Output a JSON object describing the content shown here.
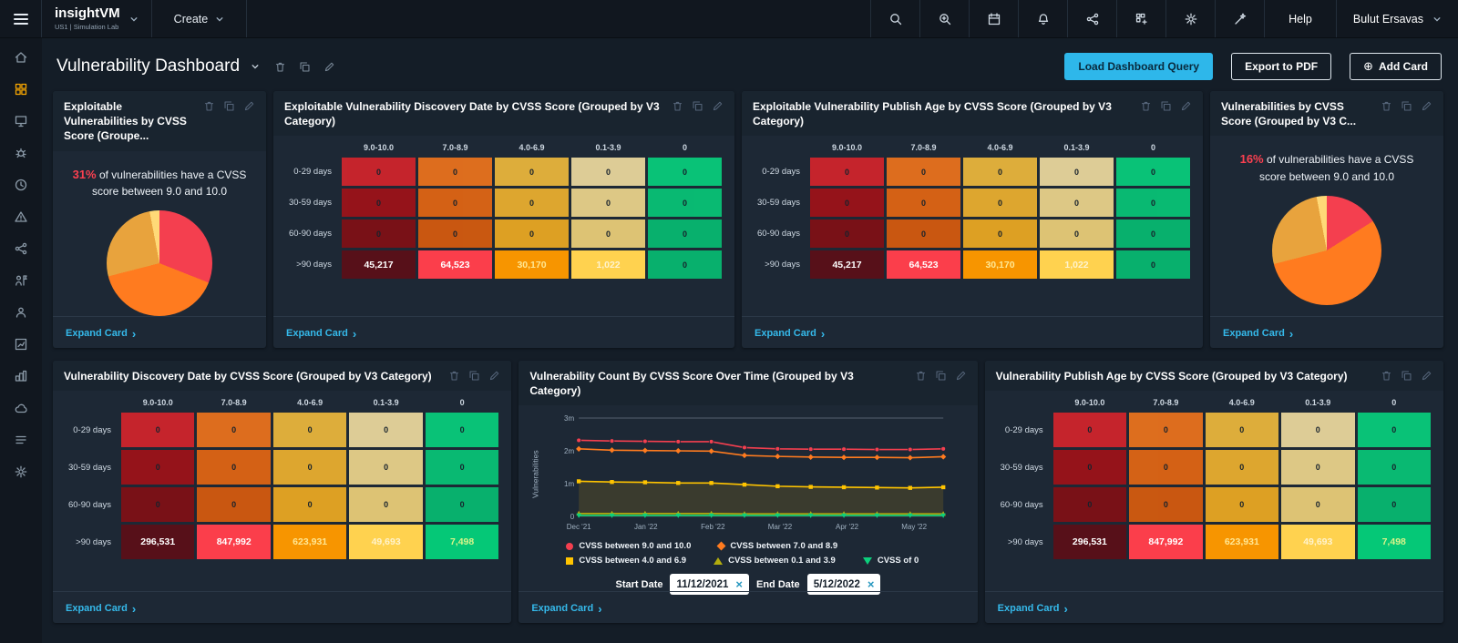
{
  "colors": {
    "accent_cyan": "#2eb7ea",
    "active_sidebar_icon": "#f7a600",
    "stat_red": "#fb4050",
    "page_background": "#141d27",
    "card_background": "#1d2835"
  },
  "topbar": {
    "brand": "insightVM",
    "brand_sub": "US1 | Simulation Lab",
    "create_label": "Create",
    "help_label": "Help",
    "user_name": "Bulut Ersavas",
    "icons": [
      "search",
      "query",
      "calendar",
      "notifications",
      "automation",
      "apps",
      "settings",
      "tools"
    ]
  },
  "sidebar": {
    "items": [
      "home",
      "dashboards",
      "assets",
      "vulnerabilities",
      "policies",
      "remediations",
      "automation",
      "goals",
      "users",
      "reports",
      "containers",
      "cloud",
      "queries",
      "settings"
    ],
    "active": "dashboards"
  },
  "page": {
    "title": "Vulnerability Dashboard",
    "actions": {
      "load_query": "Load Dashboard Query",
      "export_pdf": "Export to PDF",
      "add_card": "Add Card"
    }
  },
  "cards": {
    "pie_exploitable": {
      "title": "Exploitable Vulnerabilities by CVSS Score (Groupe...",
      "stat_pct": "31%",
      "stat_text": "of vulnerabilities have a CVSS score between 9.0 and 10.0",
      "expand": "Expand Card"
    },
    "heat_exploit_discovery": {
      "title": "Exploitable Vulnerability Discovery Date by CVSS Score (Grouped by V3 Category)",
      "expand": "Expand Card"
    },
    "heat_exploit_publish": {
      "title": "Exploitable Vulnerability Publish Age by CVSS Score (Grouped by V3 Category)",
      "expand": "Expand Card"
    },
    "pie_all": {
      "title": "Vulnerabilities by CVSS Score (Grouped by V3 C...",
      "stat_pct": "16%",
      "stat_text": "of vulnerabilities have a CVSS score between 9.0 and 10.0",
      "expand": "Expand Card"
    },
    "heat_discovery": {
      "title": "Vulnerability Discovery Date by CVSS Score (Grouped by V3 Category)",
      "expand": "Expand Card"
    },
    "line_over_time": {
      "title": "Vulnerability Count By CVSS Score Over Time (Grouped by V3 Category)",
      "start_label": "Start Date",
      "start_value": "11/12/2021",
      "end_label": "End Date",
      "end_value": "5/12/2022",
      "expand": "Expand Card"
    },
    "heat_publish": {
      "title": "Vulnerability Publish Age by CVSS Score (Grouped by V3 Category)",
      "expand": "Expand Card"
    }
  },
  "heatmap_palette": {
    "cells": [
      [
        "#e3242b",
        "#ff7a1a",
        "#ffc53d",
        "#ffe9a8",
        "#06dd83"
      ],
      [
        "#aa1016",
        "#f56c10",
        "#ffbd2e",
        "#ffe494",
        "#06d37d"
      ],
      [
        "#8a0d12",
        "#e8600b",
        "#ffb520",
        "#ffdf7f",
        "#05c877"
      ],
      [
        "#571019",
        "#fb3e4b",
        "#f79500",
        "#ffd24f",
        "#05c877"
      ]
    ],
    "row4_text": [
      "#ffffff",
      "#ffffff",
      "#ffe793",
      "#fff3cd",
      "#d9f48a"
    ],
    "zero_text": "#17212b"
  },
  "chart_data": [
    {
      "id": "pie_exploitable",
      "type": "pie",
      "title": "Exploitable Vulnerabilities by CVSS Score",
      "values": [
        31,
        40,
        26,
        3
      ],
      "colors": [
        "#f43f4f",
        "#ff7b1f",
        "#e8a33d",
        "#ffd977"
      ]
    },
    {
      "id": "heat_exploit_discovery",
      "type": "heatmap",
      "title": "Exploitable Vulnerability Discovery Date by CVSS Score (Grouped by V3 Category)",
      "columns": [
        "9.0-10.0",
        "7.0-8.9",
        "4.0-6.9",
        "0.1-3.9",
        "0"
      ],
      "rows": [
        "0-29 days",
        "30-59 days",
        "60-90 days",
        ">90 days"
      ],
      "values": [
        [
          "0",
          "0",
          "0",
          "0",
          "0"
        ],
        [
          "0",
          "0",
          "0",
          "0",
          "0"
        ],
        [
          "0",
          "0",
          "0",
          "0",
          "0"
        ],
        [
          "45,217",
          "64,523",
          "30,170",
          "1,022",
          "0"
        ]
      ]
    },
    {
      "id": "heat_exploit_publish",
      "type": "heatmap",
      "title": "Exploitable Vulnerability Publish Age by CVSS Score (Grouped by V3 Category)",
      "columns": [
        "9.0-10.0",
        "7.0-8.9",
        "4.0-6.9",
        "0.1-3.9",
        "0"
      ],
      "rows": [
        "0-29 days",
        "30-59 days",
        "60-90 days",
        ">90 days"
      ],
      "values": [
        [
          "0",
          "0",
          "0",
          "0",
          "0"
        ],
        [
          "0",
          "0",
          "0",
          "0",
          "0"
        ],
        [
          "0",
          "0",
          "0",
          "0",
          "0"
        ],
        [
          "45,217",
          "64,523",
          "30,170",
          "1,022",
          "0"
        ]
      ]
    },
    {
      "id": "pie_all",
      "type": "pie",
      "title": "Vulnerabilities by CVSS Score",
      "values": [
        16,
        55,
        26,
        3
      ],
      "colors": [
        "#f43f4f",
        "#ff7b1f",
        "#e8a33d",
        "#ffd977"
      ]
    },
    {
      "id": "heat_discovery",
      "type": "heatmap",
      "title": "Vulnerability Discovery Date by CVSS Score (Grouped by V3 Category)",
      "columns": [
        "9.0-10.0",
        "7.0-8.9",
        "4.0-6.9",
        "0.1-3.9",
        "0"
      ],
      "rows": [
        "0-29 days",
        "30-59 days",
        "60-90 days",
        ">90 days"
      ],
      "values": [
        [
          "0",
          "0",
          "0",
          "0",
          "0"
        ],
        [
          "0",
          "0",
          "0",
          "0",
          "0"
        ],
        [
          "0",
          "0",
          "0",
          "0",
          "0"
        ],
        [
          "296,531",
          "847,992",
          "623,931",
          "49,693",
          "7,498"
        ]
      ]
    },
    {
      "id": "line_over_time",
      "type": "line",
      "title": "Vulnerability Count By CVSS Score Over Time (Grouped by V3 Category)",
      "ylabel": "Vulnerabilities",
      "yticks": [
        "0",
        "1m",
        "2m",
        "3m"
      ],
      "ylim_millions": [
        0,
        3
      ],
      "x_ticks": [
        "Dec '21",
        "Jan '22",
        "Feb '22",
        "Mar '22",
        "Apr '22",
        "May '22"
      ],
      "series": [
        {
          "name": "CVSS between 9.0 and 10.0",
          "color": "#f43f4f",
          "marker": "circle",
          "values_millions": [
            2.32,
            2.3,
            2.29,
            2.28,
            2.28,
            2.1,
            2.06,
            2.05,
            2.05,
            2.04,
            2.04,
            2.06
          ]
        },
        {
          "name": "CVSS between 7.0 and 8.9",
          "color": "#ff7b1f",
          "marker": "diamond",
          "values_millions": [
            2.06,
            2.02,
            2.01,
            2.0,
            1.99,
            1.86,
            1.83,
            1.81,
            1.8,
            1.8,
            1.79,
            1.82
          ]
        },
        {
          "name": "CVSS between 4.0 and 6.9",
          "color": "#ffc400",
          "marker": "square",
          "values_millions": [
            1.07,
            1.05,
            1.04,
            1.02,
            1.02,
            0.97,
            0.92,
            0.9,
            0.89,
            0.88,
            0.87,
            0.89
          ]
        },
        {
          "name": "CVSS between 0.1 and 3.9",
          "color": "#b3ad0e",
          "marker": "triangle-up",
          "values_millions": [
            0.09,
            0.09,
            0.09,
            0.09,
            0.09,
            0.08,
            0.08,
            0.08,
            0.08,
            0.08,
            0.08,
            0.08
          ]
        },
        {
          "name": "CVSS of 0",
          "color": "#0ccf7c",
          "marker": "triangle-down",
          "values_millions": [
            0.03,
            0.03,
            0.03,
            0.03,
            0.03,
            0.03,
            0.03,
            0.03,
            0.03,
            0.03,
            0.03,
            0.03
          ]
        }
      ],
      "legend_position": "bottom",
      "grid": "top-line-only"
    },
    {
      "id": "heat_publish",
      "type": "heatmap",
      "title": "Vulnerability Publish Age by CVSS Score (Grouped by V3 Category)",
      "columns": [
        "9.0-10.0",
        "7.0-8.9",
        "4.0-6.9",
        "0.1-3.9",
        "0"
      ],
      "rows": [
        "0-29 days",
        "30-59 days",
        "60-90 days",
        ">90 days"
      ],
      "values": [
        [
          "0",
          "0",
          "0",
          "0",
          "0"
        ],
        [
          "0",
          "0",
          "0",
          "0",
          "0"
        ],
        [
          "0",
          "0",
          "0",
          "0",
          "0"
        ],
        [
          "296,531",
          "847,992",
          "623,931",
          "49,693",
          "7,498"
        ]
      ]
    }
  ]
}
